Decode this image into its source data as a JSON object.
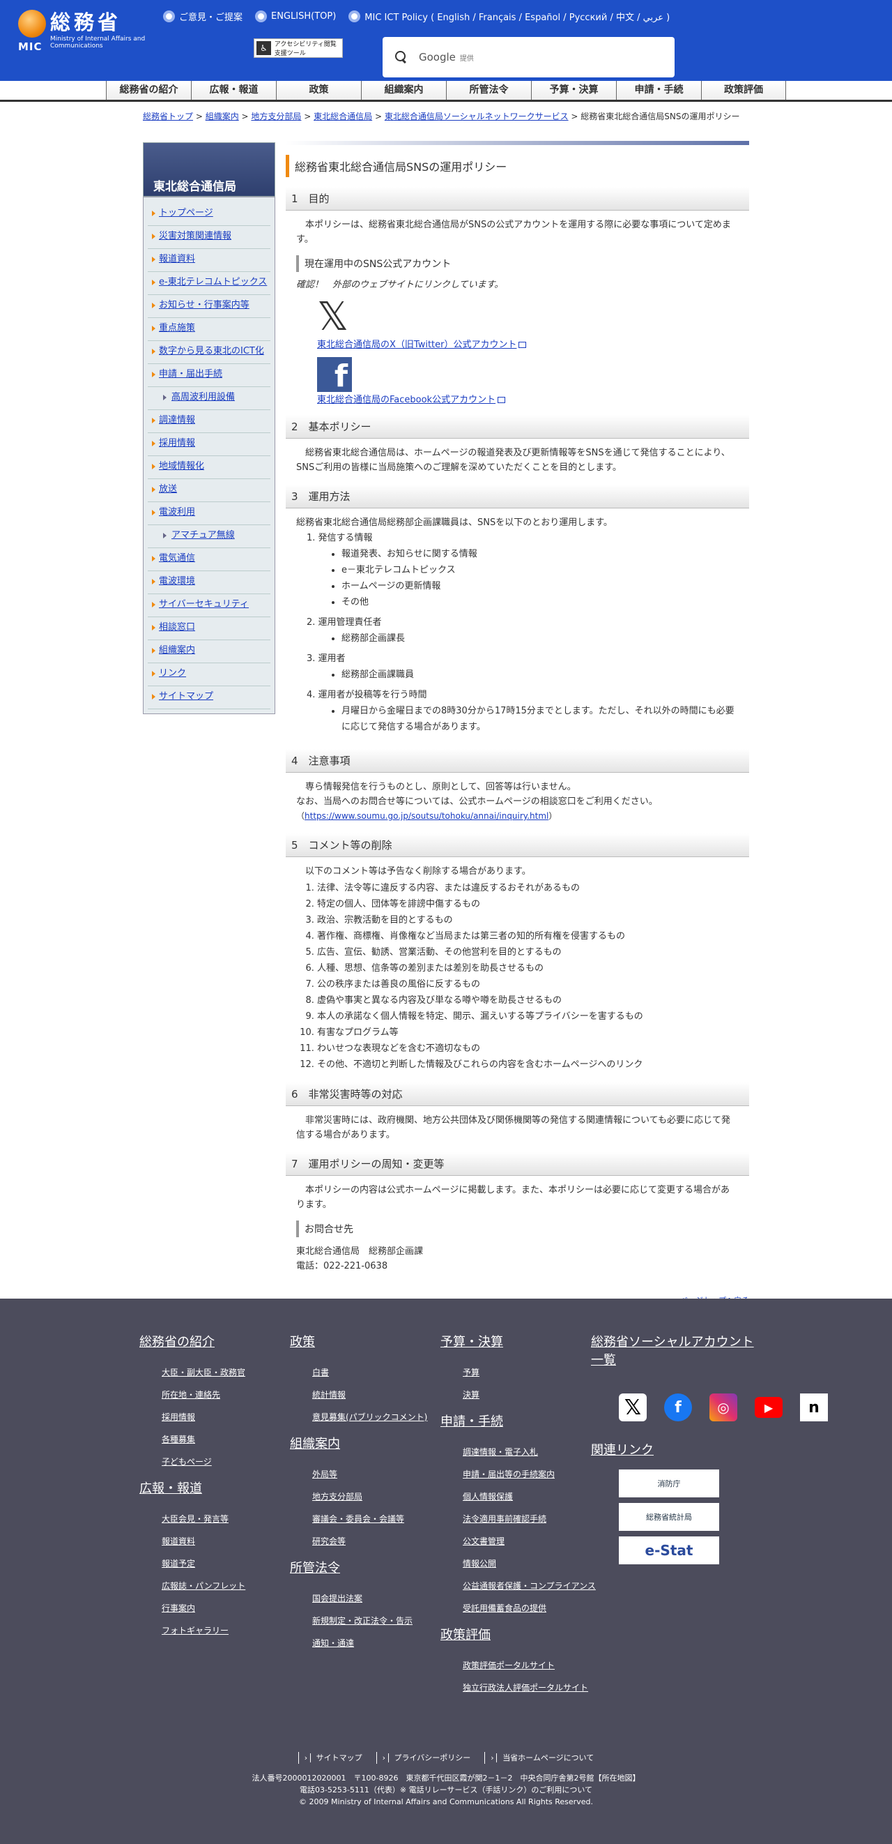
{
  "header": {
    "logo_jp": "総務省",
    "logo_mic": "MIC",
    "logo_en": "Ministry of Internal Affairs and Communications",
    "links": [
      "ご意見・ご提案",
      "ENGLISH(TOP)",
      "MIC ICT Policy ( English / Français / Español / Русский / 中文 / عربي )"
    ],
    "access": "アクセシビリティ閲覧支援ツール",
    "search": "Google",
    "search_sub": "提供"
  },
  "gnav": [
    "総務省の紹介",
    "広報・報道",
    "政策",
    "組織案内",
    "所管法令",
    "予算・決算",
    "申請・手続",
    "政策評価"
  ],
  "breadcrumb": [
    "総務省トップ",
    "組織案内",
    "地方支分部局",
    "東北総合通信局",
    "東北総合通信局ソーシャルネットワークサービス"
  ],
  "breadcrumb_current": "総務省東北総合通信局SNSの運用ポリシー",
  "side": {
    "title": "東北総合通信局",
    "items": [
      "トップページ",
      "災害対策関連情報",
      "報道資料",
      "e-東北テレコムトピックス",
      "お知らせ・行事案内等",
      "重点施策",
      "数字から見る東北のICT化",
      "申請・届出手続",
      "高周波利用設備",
      "調達情報",
      "採用情報",
      "地域情報化",
      "放送",
      "電波利用",
      "アマチュア無線",
      "電気通信",
      "電波環境",
      "サイバーセキュリティ",
      "相談窓口",
      "組織案内",
      "リンク",
      "サイトマップ"
    ]
  },
  "main": {
    "title": "総務省東北総合通信局SNSの運用ポリシー",
    "s1": "1　目的",
    "s1p": "本ポリシーは、総務省東北総合通信局がSNSの公式アカウントを運用する際に必要な事項について定めます。",
    "sns_h": "現在運用中のSNS公式アカウント",
    "note": "確認！　外部のウェブサイトにリンクしています。",
    "x_link": "東北総合通信局のX（旧Twitter）公式アカウント",
    "fb_link": "東北総合通信局のFacebook公式アカウント",
    "s2": "2　基本ポリシー",
    "s2p": "総務省東北総合通信局は、ホームページの報道発表及び更新情報等をSNSを通じて発信することにより、SNSご利用の皆様に当局施策へのご理解を深めていただくことを目的とします。",
    "s3": "3　運用方法",
    "s3p": "総務省東北総合通信局総務部企画課職員は、SNSを以下のとおり運用します。",
    "s3_1": "1. 発信する情報",
    "s3_1i": [
      "報道発表、お知らせに関する情報",
      "e－東北テレコムトピックス",
      "ホームページの更新情報",
      "その他"
    ],
    "s3_2": "2. 運用管理責任者",
    "s3_2i": "総務部企画課長",
    "s3_3": "3. 運用者",
    "s3_3i": "総務部企画課職員",
    "s3_4": "4. 運用者が投稿等を行う時間",
    "s3_4i": "月曜日から金曜日までの8時30分から17時15分までとします。ただし、それ以外の時間にも必要に応じて発信する場合があります。",
    "s4": "4　注意事項",
    "s4p1": "専ら情報発信を行うものとし、原則として、回答等は行いません。",
    "s4p2": "なお、当局へのお問合せ等については、公式ホームページの相談窓口をご利用ください。",
    "s4url": "https://www.soumu.go.jp/soutsu/tohoku/annai/inquiry.html",
    "s5": "5　コメント等の削除",
    "s5p": "以下のコメント等は予告なく削除する場合があります。",
    "s5i": [
      "法律、法令等に違反する内容、または違反するおそれがあるもの",
      "特定の個人、団体等を誹謗中傷するもの",
      "政治、宗教活動を目的とするもの",
      "著作権、商標権、肖像権など当局または第三者の知的所有権を侵害するもの",
      "広告、宣伝、勧誘、営業活動、その他営利を目的とするもの",
      "人種、思想、信条等の差別または差別を助長させるもの",
      "公の秩序または善良の風俗に反するもの",
      "虚偽や事実と異なる内容及び単なる噂や噂を助長させるもの",
      "本人の承諾なく個人情報を特定、開示、漏えいする等プライバシーを害するもの",
      "有害なプログラム等",
      "わいせつな表現などを含む不適切なもの",
      "その他、不適切と判断した情報及びこれらの内容を含むホームページへのリンク"
    ],
    "s6": "6　非常災害時等の対応",
    "s6p": "非常災害時には、政府機関、地方公共団体及び関係機関等の発信する関連情報についても必要に応じて発信する場合があります。",
    "s7": "7　運用ポリシーの周知・変更等",
    "s7p": "本ポリシーの内容は公式ホームページに掲載します。また、本ポリシーは必要に応じて変更する場合があります。",
    "contact_h": "お問合せ先",
    "contact1": "東北総合通信局　総務部企画課",
    "contact2": "電話：022-221-0638",
    "pagetop": "ページトップへ戻る"
  },
  "footer": {
    "c1": {
      "h1": "総務省の紹介",
      "i1": [
        "大臣・副大臣・政務官",
        "所在地・連絡先",
        "採用情報",
        "各種募集",
        "子どもページ"
      ],
      "h2": "広報・報道",
      "i2": [
        "大臣会見・発言等",
        "報道資料",
        "報道予定",
        "広報誌・パンフレット",
        "行事案内",
        "フォトギャラリー"
      ]
    },
    "c2": {
      "h1": "政策",
      "i1": [
        "白書",
        "統計情報",
        "意見募集(パブリックコメント)"
      ],
      "h2": "組織案内",
      "i2": [
        "外局等",
        "地方支分部局",
        "審議会・委員会・会議等",
        "研究会等"
      ],
      "h3": "所管法令",
      "i3": [
        "国会提出法案",
        "新規制定・改正法令・告示",
        "通知・通達"
      ]
    },
    "c3": {
      "h1": "予算・決算",
      "i1": [
        "予算",
        "決算"
      ],
      "h2": "申請・手続",
      "i2": [
        "調達情報・電子入札",
        "申請・届出等の手続案内",
        "個人情報保護",
        "法令適用事前確認手続",
        "公文書管理",
        "情報公開",
        "公益通報者保護・コンプライアンス",
        "受託用備蓄食品の提供"
      ],
      "h3": "政策評価",
      "i3": [
        "政策評価ポータルサイト",
        "独立行政法人評価ポータルサイト"
      ]
    },
    "c4": {
      "h1": "総務省ソーシャルアカウント一覧",
      "h2": "関連リンク",
      "rel": [
        "消防庁",
        "総務省統計局",
        "e-Stat"
      ]
    },
    "bottom_links": [
      "サイトマップ",
      "プライバシーポリシー",
      "当省ホームページについて"
    ],
    "addr": "法人番号2000012020001　〒100-8926　東京都千代田区霞が関2－1－2　中央合同庁舎第2号館【所在地図】",
    "tel": "電話03-5253-5111（代表）※ 電話リレーサービス（手話リンク）のご利用について",
    "copy": "© 2009 Ministry of Internal Affairs and Communications All Rights Reserved."
  }
}
